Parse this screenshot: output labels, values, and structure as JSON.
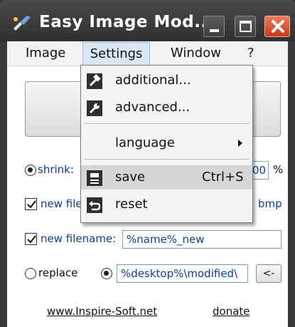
{
  "window": {
    "title": "Easy Image Mod...",
    "close_color": "#d9451f"
  },
  "menubar": {
    "image": "Image",
    "settings": "Settings",
    "window": "Window",
    "help": "?"
  },
  "settings_menu": {
    "items": [
      {
        "label": "additional...",
        "icon": "hammer-icon"
      },
      {
        "label": "advanced...",
        "icon": "wrench-icon"
      },
      {
        "label": "language",
        "icon": "submenu-arrow-icon"
      },
      {
        "label": "save",
        "shortcut": "Ctrl+S",
        "icon": "save-icon"
      },
      {
        "label": "reset",
        "icon": "reset-icon"
      }
    ]
  },
  "form": {
    "shrink_label": "shrink:",
    "shrink_value_tail": "00",
    "percent_sign": "%",
    "new_file_label_partial": "new file",
    "bmp_label_partial": "bmp",
    "new_filename_label": "new filename:",
    "new_filename_value": "%name%_new",
    "replace_label": "replace",
    "path_value": "%desktop%\\modified\\",
    "browse_button": "<-"
  },
  "footer": {
    "website": "www.Inspire-Soft.net",
    "donate": "donate"
  }
}
